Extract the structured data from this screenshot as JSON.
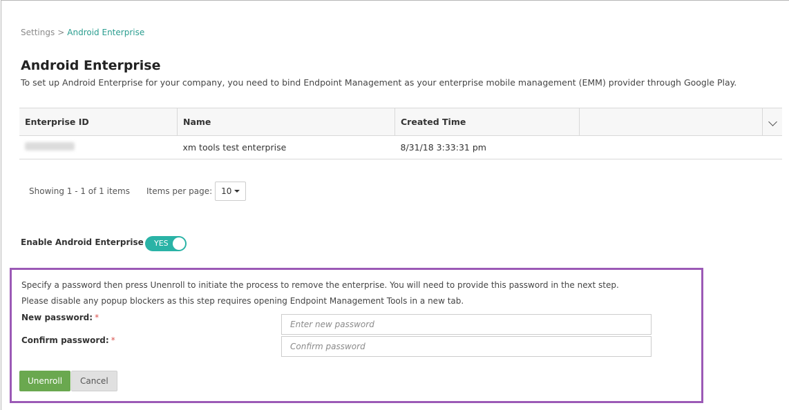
{
  "breadcrumb": {
    "parent": "Settings",
    "separator": ">",
    "current": "Android Enterprise"
  },
  "page": {
    "title": "Android Enterprise",
    "description": "To set up Android Enterprise for your company, you need to bind Endpoint Management as your enterprise mobile management (EMM) provider through Google Play."
  },
  "table": {
    "columns": [
      "Enterprise ID",
      "Name",
      "Created Time",
      ""
    ],
    "rows": [
      {
        "enterprise_id": "",
        "name": "xm tools test enterprise",
        "created": "8/31/18 3:33:31 pm"
      }
    ]
  },
  "pager": {
    "showing": "Showing 1 - 1 of 1 items",
    "items_per_page_label": "Items per page:",
    "items_per_page_value": "10"
  },
  "enable": {
    "label": "Enable Android Enterprise",
    "toggle": "YES",
    "enabled": true
  },
  "unenroll": {
    "line1": "Specify a password then press Unenroll to initiate the process to remove the enterprise. You will need to provide this password in the next step.",
    "line2": "Please disable any popup blockers as this step requires opening Endpoint Management Tools in a new tab.",
    "new_password_label": "New password:",
    "new_password_placeholder": "Enter new password",
    "confirm_password_label": "Confirm password:",
    "confirm_password_placeholder": "Confirm password",
    "required_mark": "*",
    "unenroll_button": "Unenroll",
    "cancel_button": "Cancel"
  },
  "colors": {
    "accent": "#2ab3a6",
    "primary_button": "#6aa84f",
    "highlight_border": "#9b59b6",
    "required": "#d9534f"
  },
  "icons": {
    "column_menu": "chevron-down-icon",
    "dropdown": "caret-down-icon"
  }
}
